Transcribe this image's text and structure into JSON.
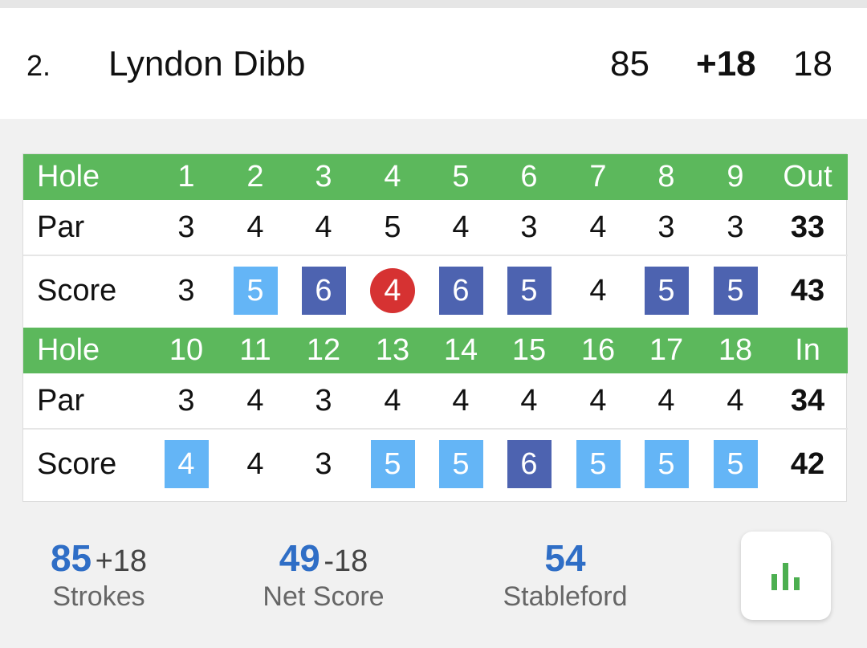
{
  "player": {
    "rank": "2.",
    "name": "Lyndon Dibb",
    "strokes": "85",
    "to_par": "+18",
    "thru": "18"
  },
  "front": {
    "hole_label": "Hole",
    "par_label": "Par",
    "score_label": "Score",
    "total_label": "Out",
    "holes": [
      "1",
      "2",
      "3",
      "4",
      "5",
      "6",
      "7",
      "8",
      "9"
    ],
    "par": [
      "3",
      "4",
      "4",
      "5",
      "4",
      "3",
      "4",
      "3",
      "3"
    ],
    "par_total": "33",
    "score": [
      "3",
      "5",
      "6",
      "4",
      "6",
      "5",
      "4",
      "5",
      "5"
    ],
    "score_style": [
      "plain",
      "bogey",
      "double",
      "birdie",
      "double",
      "double",
      "plain",
      "double",
      "double"
    ],
    "score_total": "43"
  },
  "back": {
    "hole_label": "Hole",
    "par_label": "Par",
    "score_label": "Score",
    "total_label": "In",
    "holes": [
      "10",
      "11",
      "12",
      "13",
      "14",
      "15",
      "16",
      "17",
      "18"
    ],
    "par": [
      "3",
      "4",
      "3",
      "4",
      "4",
      "4",
      "4",
      "4",
      "4"
    ],
    "par_total": "34",
    "score": [
      "4",
      "4",
      "3",
      "5",
      "5",
      "6",
      "5",
      "5",
      "5"
    ],
    "score_style": [
      "bogey",
      "plain",
      "plain",
      "bogey",
      "bogey",
      "double",
      "bogey",
      "bogey",
      "bogey"
    ],
    "score_total": "42"
  },
  "summary": {
    "strokes": {
      "value": "85",
      "diff": "+18",
      "label": "Strokes"
    },
    "net": {
      "value": "49",
      "diff": "-18",
      "label": "Net Score"
    },
    "stableford": {
      "value": "54",
      "label": "Stableford"
    }
  },
  "colors": {
    "header_green": "#5cb85c",
    "bogey": "#64b5f6",
    "double_bogey": "#4d63b0",
    "birdie": "#d63232",
    "accent_blue": "#2f6ec6"
  },
  "icons": {
    "stats": "bar-chart-icon"
  }
}
